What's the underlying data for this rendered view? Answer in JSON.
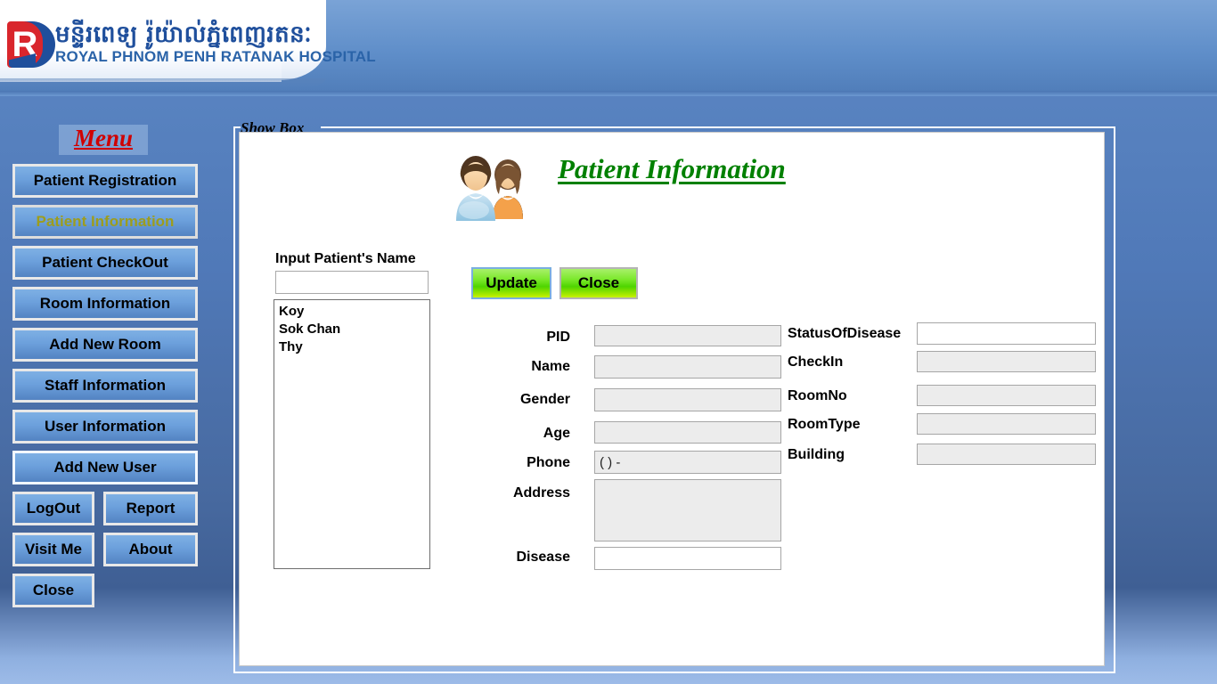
{
  "header": {
    "logo_icon": "hospital-rb-logo",
    "khmer_title": "មន្ទីរពេទ្យ  រ៉ូយ៉ាល់ភ្នំពេញរតនៈ",
    "english_title": "ROYAL PHNOM PENH RATANAK HOSPITAL"
  },
  "sidebar": {
    "title": "Menu",
    "items": [
      {
        "label": "Patient Registration",
        "active": false
      },
      {
        "label": "Patient Information",
        "active": true
      },
      {
        "label": "Patient CheckOut",
        "active": false
      },
      {
        "label": "Room Information",
        "active": false
      },
      {
        "label": "Add New Room",
        "active": false
      },
      {
        "label": "Staff Information",
        "active": false
      },
      {
        "label": "User Information",
        "active": false
      },
      {
        "label": "Add New User",
        "active": false
      }
    ],
    "pairs": [
      {
        "left": "LogOut",
        "right": "Report"
      },
      {
        "left": "Visit Me",
        "right": "About"
      }
    ],
    "close_label": "Close"
  },
  "groupbox": {
    "legend": "Show Box"
  },
  "main": {
    "title": "Patient Information",
    "avatar_icon": "couple-avatar-icon",
    "search": {
      "label": "Input Patient's Name",
      "value": "",
      "placeholder": ""
    },
    "patient_list": [
      "Koy",
      "Sok Chan",
      "Thy"
    ],
    "buttons": {
      "update": "Update",
      "close": "Close"
    },
    "left_fields": [
      {
        "label": "PID",
        "value": ""
      },
      {
        "label": "Name",
        "value": ""
      },
      {
        "label": "Gender",
        "value": ""
      },
      {
        "label": "Age",
        "value": ""
      },
      {
        "label": "Phone",
        "value": "(  )    -"
      },
      {
        "label": "Address",
        "value": ""
      },
      {
        "label": "Disease",
        "value": ""
      }
    ],
    "right_fields": [
      {
        "label": "StatusOfDisease",
        "value": ""
      },
      {
        "label": "CheckIn",
        "value": ""
      },
      {
        "label": "RoomNo",
        "value": ""
      },
      {
        "label": "RoomType",
        "value": ""
      },
      {
        "label": "Building",
        "value": ""
      }
    ]
  },
  "colors": {
    "background_blue": "#5079b8",
    "title_green": "#008000",
    "menu_red": "#d00000",
    "active_menu_olive": "#9d9d1e",
    "button_green": "#4fd400"
  }
}
